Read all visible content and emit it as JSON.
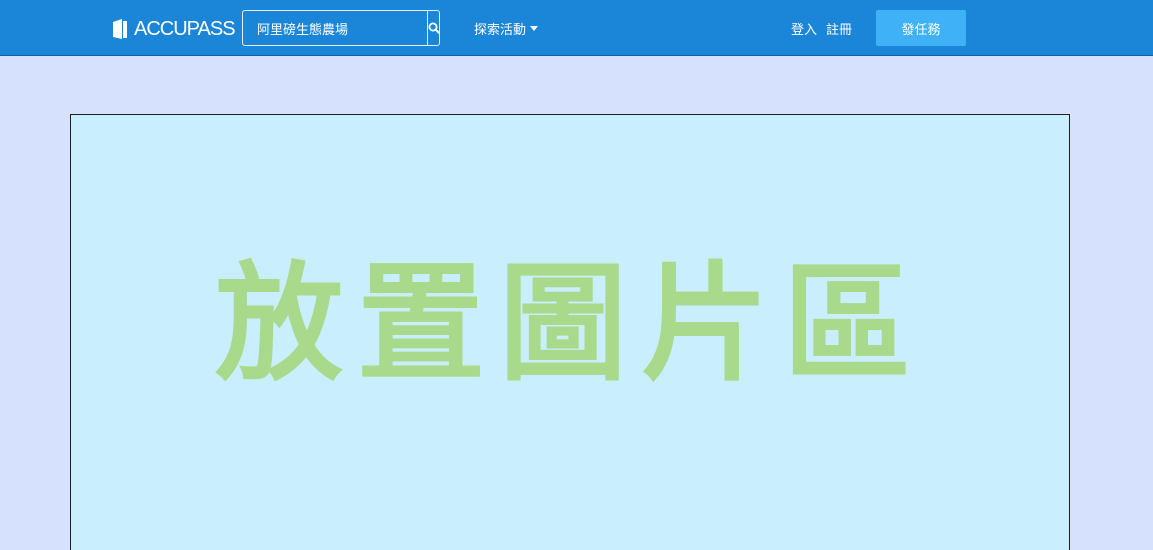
{
  "header": {
    "logo_text": "ACCUPASS",
    "search": {
      "value": "阿里磅生態農場",
      "icon": "search-icon"
    },
    "explore_label": "探索活動",
    "login_label": "登入",
    "register_label": "註冊",
    "publish_label": "發任務"
  },
  "main": {
    "image_placeholder_text": "放置圖片區"
  },
  "colors": {
    "navbar": "#1b86d8",
    "publish_button": "#3fb1f6",
    "page_background": "#d5e1fd",
    "placeholder_background": "#c9eefd",
    "placeholder_text": "#a9d98a"
  }
}
